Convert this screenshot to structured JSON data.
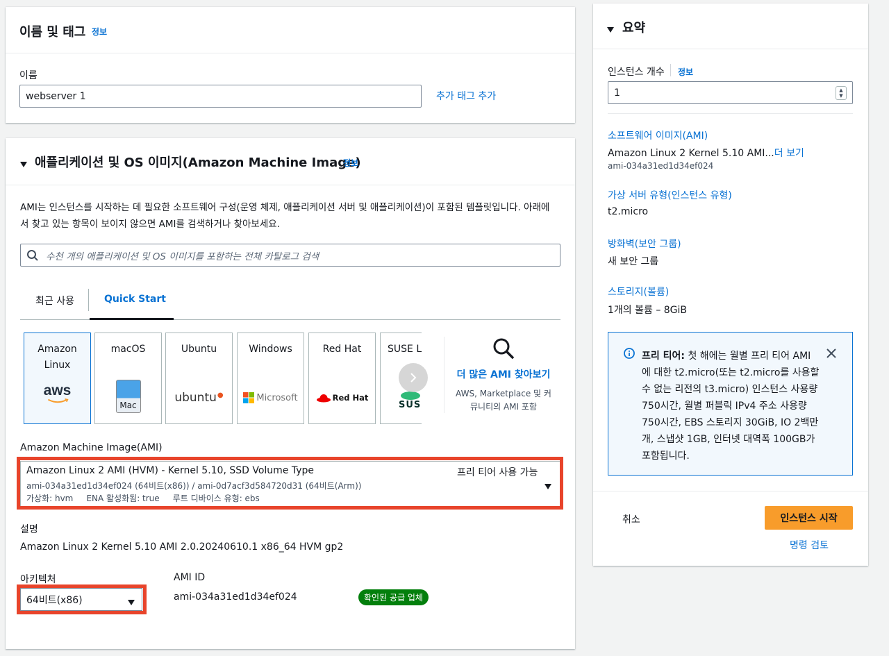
{
  "name_section": {
    "title": "이름 및 태그",
    "info": "정보",
    "name_label": "이름",
    "name_value": "webserver 1",
    "add_tag": "추가 태그 추가"
  },
  "ami_section": {
    "title": "애플리케이션 및 OS 이미지(Amazon Machine Image)",
    "info": "정보",
    "desc_line1": "AMI는 인스턴스를 시작하는 데 필요한 소프트웨어 구성(운영 체제, 애플리케이션 서버 및 애플리케이션)이 포함된 템플릿입니다. 아래에",
    "desc_line2": "서 찾고 있는 항목이 보이지 않으면 AMI를 검색하거나 찾아보세요.",
    "search_placeholder": "수천 개의 애플리케이션 및 OS 이미지를 포함하는 전체 카탈로그 검색",
    "tabs": [
      "최근 사용",
      "Quick Start"
    ],
    "tiles": {
      "amazon_linux": "Amazon Linux",
      "amazon_logo": "aws",
      "macos": "macOS",
      "mac_logo": "Mac",
      "ubuntu": "Ubuntu",
      "ubuntu_logo": "ubuntu",
      "windows": "Windows",
      "windows_logo": "Microsoft",
      "redhat": "Red Hat",
      "redhat_logo": "Red Hat",
      "suse": "SUSE Li",
      "suse_logo": "SUS"
    },
    "more_ami_title": "더 많은 AMI 찾아보기",
    "more_ami_desc_line1": "AWS, Marketplace 및 커",
    "more_ami_desc_line2": "뮤니티의 AMI 포함",
    "ami_label": "Amazon Machine Image(AMI)",
    "ami_name": "Amazon Linux 2 AMI (HVM) - Kernel 5.10, SSD Volume Type",
    "ami_free": "프리 티어 사용 가능",
    "ami_ids": "ami-034a31ed1d34ef024 (64비트(x86)) / ami-0d7acf3d584720d31 (64비트(Arm))",
    "ami_meta": "가상화: hvm     ENA 활성화됨: true     루트 디바이스 유형: ebs",
    "desc_label": "설명",
    "desc_value": "Amazon Linux 2 Kernel 5.10 AMI 2.0.20240610.1 x86_64 HVM gp2",
    "arch_label": "아키텍처",
    "arch_value": "64비트(x86)",
    "amiid_label": "AMI ID",
    "amiid_value": "ami-034a31ed1d34ef024",
    "verified_badge": "확인된 공급 업체"
  },
  "summary": {
    "title": "요약",
    "count_label": "인스턴스 개수",
    "info": "정보",
    "count_value": "1",
    "software_label": "소프트웨어 이미지(AMI)",
    "software_value": "Amazon Linux 2 Kernel 5.10 AMI...",
    "more": "더 보기",
    "software_id": "ami-034a31ed1d34ef024",
    "type_label": "가상 서버 유형(인스턴스 유형)",
    "type_value": "t2.micro",
    "firewall_label": "방화벽(보안 그룹)",
    "firewall_value": "새 보안 그룹",
    "storage_label": "스토리지(볼륨)",
    "storage_value": "1개의 볼륨 – 8GiB",
    "free_tier_title": "프리 티어:",
    "free_tier_lines": [
      "첫 해에는 월별 프리 티어 AMI",
      "에 대한 t2.micro(또는 t2.micro를 사용할",
      "수 없는 리전의 t3.micro) 인스턴스 사용량",
      "750시간, 월별 퍼블릭 IPv4 주소 사용량",
      "750시간, EBS 스토리지 30GiB, IO 2백만",
      "개, 스냅샷 1GB, 인터넷 대역폭 100GB가",
      "포함됩니다."
    ],
    "cancel": "취소",
    "launch": "인스턴스 시작",
    "review": "명령 검토"
  },
  "colors": {
    "link": "#0972d3",
    "highlight": "#e8442b",
    "primary_button": "#f89c2b",
    "badge": "#037f0c",
    "info_box_bg": "#f2f8fd",
    "info_box_border": "#0972d3"
  }
}
